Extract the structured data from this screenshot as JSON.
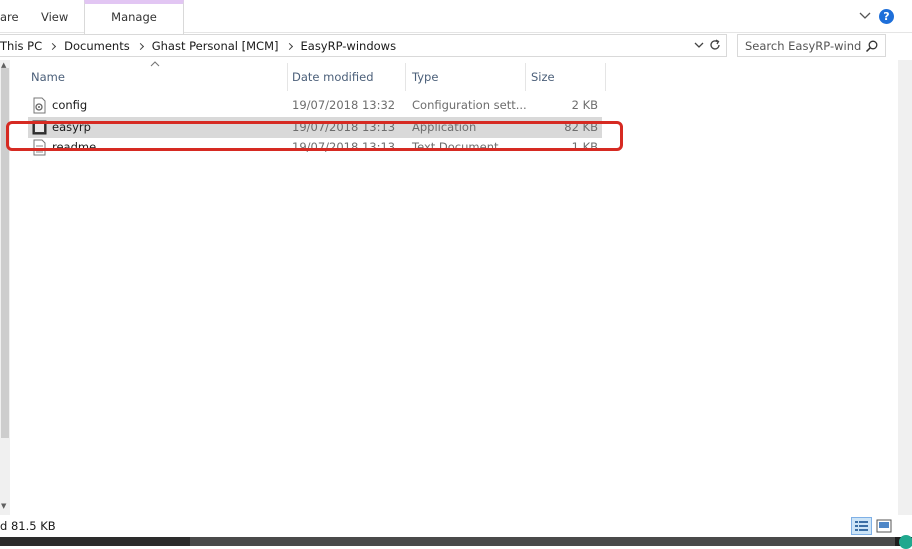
{
  "ribbon": {
    "tabs": [
      "are",
      "View",
      "Manage"
    ]
  },
  "address": {
    "crumbs": [
      "This PC",
      "Documents",
      "Ghast Personal [MCM]",
      "EasyRP-windows"
    ]
  },
  "search": {
    "placeholder": "Search EasyRP-wind"
  },
  "columns": {
    "name": "Name",
    "date": "Date modified",
    "type": "Type",
    "size": "Size"
  },
  "files": [
    {
      "name": "config",
      "date": "19/07/2018 13:32",
      "type": "Configuration sett...",
      "size": "2 KB",
      "icon": "config-file-icon"
    },
    {
      "name": "easyrp",
      "date": "19/07/2018 13:13",
      "type": "Application",
      "size": "82 KB",
      "icon": "application-icon"
    },
    {
      "name": "readme",
      "date": "19/07/2018 13:13",
      "type": "Text Document",
      "size": "1 KB",
      "icon": "text-file-icon"
    }
  ],
  "status": {
    "text": "d  81.5 KB"
  },
  "colors": {
    "highlight": "#d62a22",
    "manage_tab_accent": "#e2c6f3",
    "selected_row": "#d9d9d9",
    "help": "#1e6fd9"
  }
}
